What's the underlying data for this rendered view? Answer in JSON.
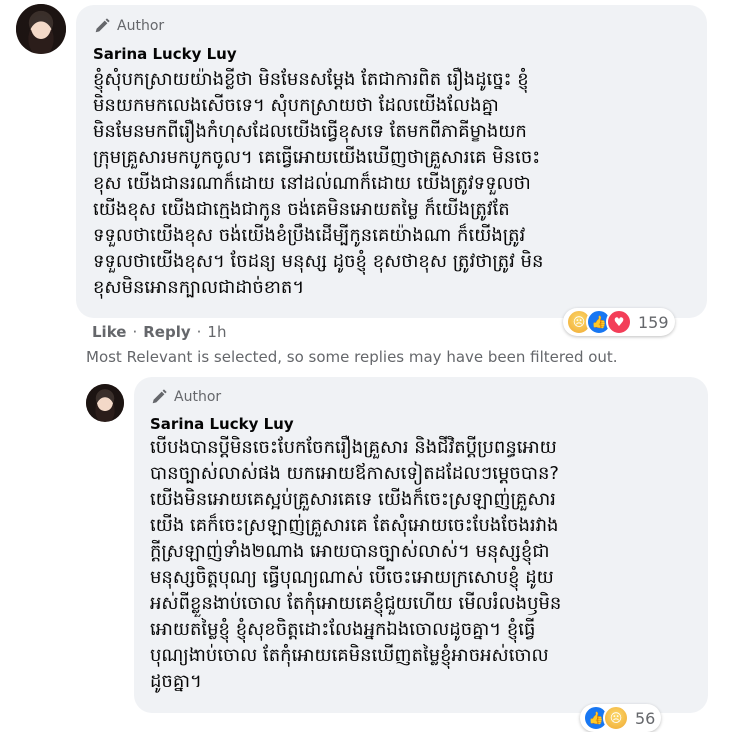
{
  "comment1": {
    "badge": "Author",
    "name": "Sarina Lucky Luy",
    "text": "ខ្ញុំសុំបកស្រាយយ៉ាងខ្លីថា មិនមែនសម្តែង តែជាការពិត រឿងដូច្នេះ ខ្ញុំ\nមិនយកមកលេងសើចទេ។ សុំបកស្រាយថា ដែលយើងលែងគ្នា\nមិនមែនមកពីរឿងកំហុសដែលយើងធ្វើខុសទេ តែមកពីភាគីម្ខាងយក\nក្រុមគ្រួសារមកបូកចូល។ គេធ្វើអោយយើងឃើញថាគ្រួសារគេ មិនចេះ\nខុស យើងជានរណាក៏ដោយ នៅដល់ណាក៏ដោយ យើងត្រូវទទួលថា\nយើងខុស យើងជាក្មេងជាកូន ចង់គេមិនអោយតម្លៃ ក៏យើងត្រូវតែ\nទទួលថាយើងខុស ចង់យើងខំប្រឹងដើម្បីកូនគេយ៉ាងណា ក៏យើងត្រូវ\nទទួលថាយើងខុស។ ចែដន្យ មនុស្ស ដូចខ្ញុំ ខុសថាខុស ត្រូវថាត្រូវ មិន\nខុសមិនអោនក្បាលជាដាច់ខាត។",
    "actions": {
      "like": "Like",
      "sep1": "·",
      "reply": "Reply",
      "sep2": "·",
      "time": "1h"
    },
    "reactions": {
      "count": "159",
      "icons": [
        "sad-icon",
        "like-icon",
        "love-icon"
      ]
    }
  },
  "notice": "Most Relevant is selected, so some replies may have been filtered out.",
  "comment2": {
    "badge": "Author",
    "name": "Sarina Lucky Luy",
    "text": "បើបងបានប្តីមិនចេះបែកចែករឿងគ្រួសារ និងជីវិតប្តីប្រពន្ធអោយ\nបានច្បាស់លាស់ផង យកអោយឪកាសទៀតដដែលៗម្តេចបាន?\nយើងមិនអោយគេស្អប់គ្រួសារគេទេ យើងក៏ចេះស្រឡាញ់គ្រួសារ\nយើង គេក៏ចេះស្រឡាញ់គ្រួសារគេ តែសុំអោយចេះបែងចែងរវាង\nក្តីស្រឡាញ់ទាំង២ណាង អោយបានច្បាស់លាស់។ មនុស្សខ្ញុំជា\nមនុស្សចិត្តបុណ្យ ធ្វើបុណ្យណាស់ បើចេះអោយក្រសោបខ្ញុំ ដូយ\nអស់ពីខ្លួនងាប់ចោល តែកុំអោយគេខ្ញុំជួយហើយ មើលរំលងឫមិន\nអោយតម្លៃខ្ញុំ ខ្ញុំសុខចិត្តដោះលែងអ្នកឯងចោលដូចគ្នា។ ខ្ញុំធ្វើ\nបុណ្យងាប់ចោល តែកុំអោយគេមិនឃើញតម្លៃខ្ញុំអាចអស់ចោល\nដូចគ្នា។",
    "reactions": {
      "count": "56"
    }
  }
}
